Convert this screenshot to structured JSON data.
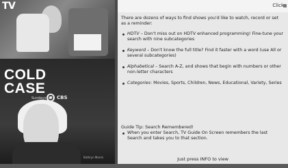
{
  "window": {
    "logo": "TV",
    "header_text": "Click"
  },
  "poster": {
    "title_line1": "COLD",
    "title_line2": "CASE",
    "subtitle": "Sundays 8/7c",
    "network": "CBS",
    "credit": "Kathryn Morris"
  },
  "content": {
    "intro": "There are dozens of ways to find shows you'd like to watch, record or set as a reminder:",
    "bullets": [
      {
        "key": "HDTV",
        "text": " – Don't miss out on HDTV enhanced programming! Fine-tune your search with nine subcategories"
      },
      {
        "key": "Keyword",
        "text": " – Don't know the full title? Find it faster with a word (use All or several subcategories)"
      },
      {
        "key": "Alphabetical",
        "text": " – Search A-Z, and shows that begin with numbers or other non-letter characters"
      },
      {
        "key": "Categories",
        "text": ": Movies, Sports, Children, News, Educational, Variety, Series"
      }
    ],
    "tip_title": "Guide Tip: Search Remembered!",
    "tip_text": "When you enter Search, TV Guide On Screen remembers the last Search and takes you to that section.",
    "footer": "Just press INFO to view"
  }
}
